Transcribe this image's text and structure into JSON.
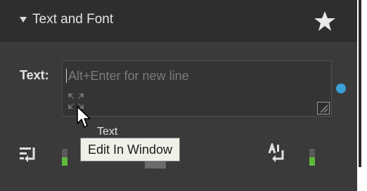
{
  "header": {
    "title": "Text and Font"
  },
  "text_field": {
    "label": "Text:",
    "placeholder": "Alt+Enter for new line"
  },
  "tooltip": {
    "ghost_text": "Text",
    "text": "Edit In Window"
  },
  "colors": {
    "panel_bg": "#3a3a3a",
    "header_bg": "#2e2e2e",
    "indicator_dot": "#3aa0d8",
    "meter_fill": "#5fb83a"
  },
  "meters": {
    "left_level": 0.5,
    "right_level": 0.5
  }
}
